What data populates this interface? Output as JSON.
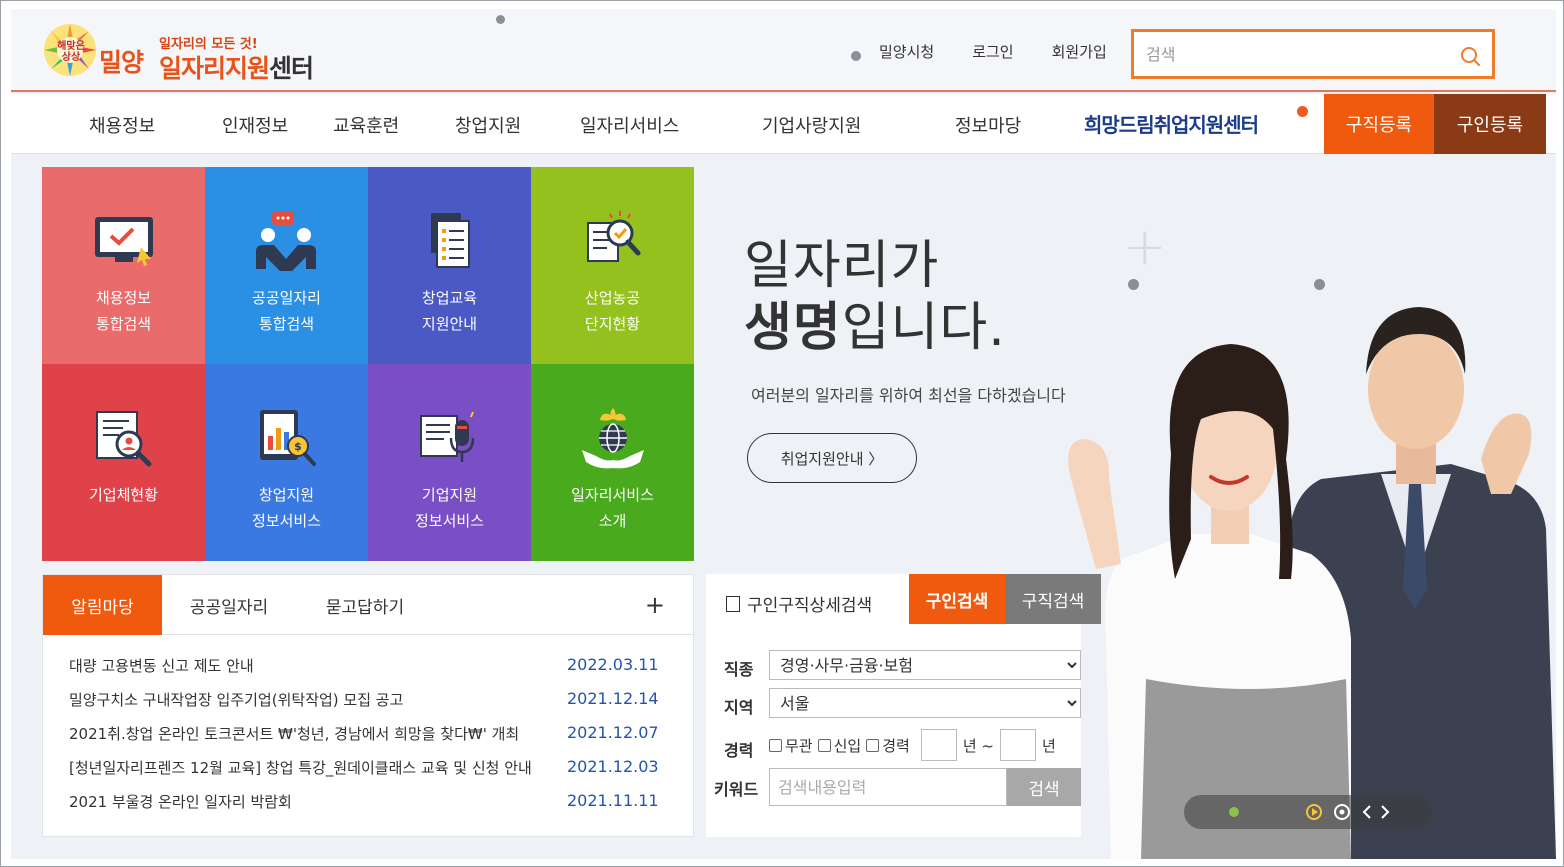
{
  "header": {
    "logo_small": "해맞은\n상상",
    "logo_city": "밀양",
    "logo_tagline": "일자리의 모든 것!",
    "logo_main_orange": "일자리지원",
    "logo_main_dark": "센터",
    "links": [
      "밀양시청",
      "로그인",
      "회원가입"
    ],
    "search_placeholder": "검색"
  },
  "nav": {
    "items": [
      "채용정보",
      "인재정보",
      "교육훈련",
      "창업지원",
      "일자리서비스",
      "기업사랑지원",
      "정보마당"
    ],
    "hope_center": "희망드림취업지원센터",
    "jobseek_register": "구직등록",
    "recruit_register": "구인등록"
  },
  "tiles": [
    {
      "label": "채용정보\n통합검색",
      "color": "#e96b6b",
      "icon": "monitor-check-icon"
    },
    {
      "label": "공공일자리\n통합검색",
      "color": "#2b8fe3",
      "icon": "people-chat-icon"
    },
    {
      "label": "창업교육\n지원안내",
      "color": "#4a59c4",
      "icon": "document-list-icon"
    },
    {
      "label": "산업농공\n단지현황",
      "color": "#94c11e",
      "icon": "magnifier-document-icon"
    },
    {
      "label": "기업체현황",
      "color": "#e0424a",
      "icon": "search-report-icon"
    },
    {
      "label": "창업지원\n정보서비스",
      "color": "#3a78e2",
      "icon": "chart-coin-icon"
    },
    {
      "label": "기업지원\n정보서비스",
      "color": "#7a4ec4",
      "icon": "document-mic-icon"
    },
    {
      "label": "일자리서비스\n소개",
      "color": "#4aaa1e",
      "icon": "globe-hands-icon"
    }
  ],
  "hero": {
    "line1": "일자리가",
    "line2_bold": "생명",
    "line2_rest": "입니다.",
    "subtitle": "여러분의 일자리를 위하여 최선을 다하겠습니다",
    "button": "취업지원안내 〉"
  },
  "board": {
    "tabs": [
      "알림마당",
      "공공일자리",
      "묻고답하기"
    ],
    "plus": "+",
    "rows": [
      {
        "title": "대량 고용변동 신고 제도 안내",
        "date": "2022.03.11"
      },
      {
        "title": "밀양구치소 구내작업장 입주기업(위탁작업) 모집 공고",
        "date": "2021.12.14"
      },
      {
        "title": "2021취.창업 온라인 토크콘서트 ₩'청년, 경남에서 희망을 찾다₩' 개최",
        "date": "2021.12.07"
      },
      {
        "title": "[청년일자리프렌즈 12월 교육] 창업 특강_원데이클래스 교육 및 신청 안내",
        "date": "2021.12.03"
      },
      {
        "title": "2021 부울경 온라인 일자리 박람회",
        "date": "2021.11.11"
      }
    ]
  },
  "job_search": {
    "title": "구인구직상세검색",
    "tab_recruit": "구인검색",
    "tab_jobseek": "구직검색",
    "label_category": "직종",
    "category_value": "경영·사무·금융·보험",
    "label_region": "지역",
    "region_value": "서울",
    "label_career": "경력",
    "career_options": [
      "무관",
      "신입",
      "경력"
    ],
    "year_unit": "년 ~",
    "year_unit_end": "년",
    "label_keyword": "키워드",
    "keyword_placeholder": "검색내용입력",
    "search_button": "검색"
  },
  "colors": {
    "accent_orange": "#f05a0f",
    "accent_brown": "#8a3a14",
    "date_blue": "#2255aa"
  }
}
